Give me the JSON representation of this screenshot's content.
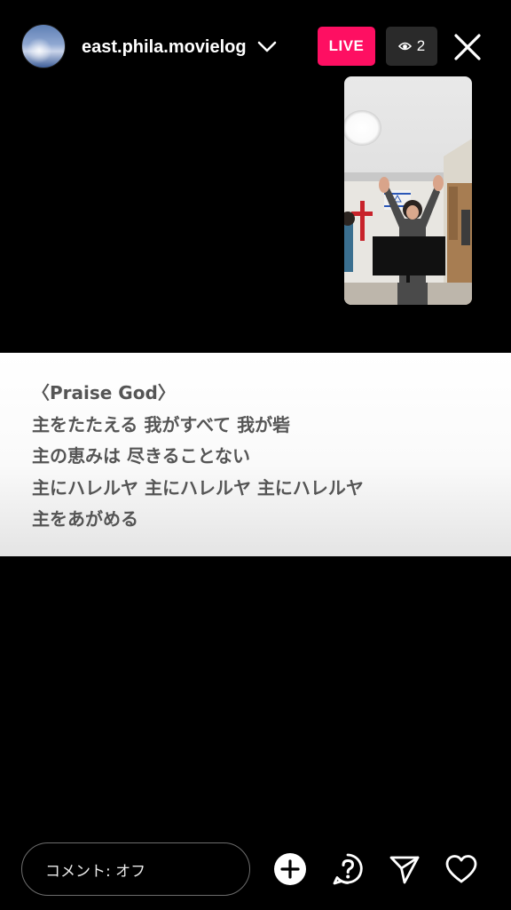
{
  "header": {
    "username": "east.phila.movielog",
    "live_label": "LIVE",
    "viewer_count": "2"
  },
  "lyrics": {
    "lines": [
      "〈Praise God〉",
      "主をたたえる 我がすべて 我が砦",
      "主の恵みは 尽きることない",
      "主にハレルヤ 主にハレルヤ 主にハレルヤ",
      "主をあがめる"
    ]
  },
  "bottom_bar": {
    "comment_placeholder": "コメント: オフ",
    "icons": [
      "add-icon",
      "question-icon",
      "send-icon",
      "heart-icon"
    ]
  },
  "colors": {
    "live_badge": "#fe0f62",
    "viewer_badge": "#2a2a2a",
    "background": "#000000",
    "lyrics_text": "#555555"
  }
}
